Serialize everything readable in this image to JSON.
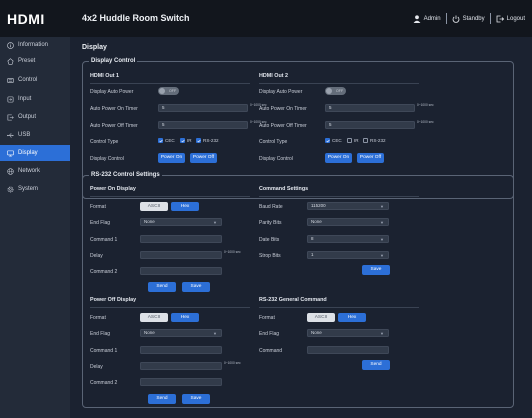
{
  "header": {
    "title": "4x2 Huddle Room Switch",
    "logo": "HDMI",
    "user": "Admin",
    "standby": "Standby",
    "logout": "Logout"
  },
  "sidebar": {
    "items": [
      {
        "label": "Information",
        "icon": "info-icon"
      },
      {
        "label": "Preset",
        "icon": "preset-icon"
      },
      {
        "label": "Control",
        "icon": "control-icon"
      },
      {
        "label": "Input",
        "icon": "input-icon"
      },
      {
        "label": "Output",
        "icon": "output-icon"
      },
      {
        "label": "USB",
        "icon": "usb-icon"
      },
      {
        "label": "Display",
        "icon": "display-icon",
        "active": true
      },
      {
        "label": "Network",
        "icon": "network-icon"
      },
      {
        "label": "System",
        "icon": "system-icon"
      }
    ]
  },
  "page_title": "Display",
  "display_control": {
    "legend": "Display Control",
    "out1": {
      "title": "HDMI Out 1",
      "auto_power_label": "Display Auto Power",
      "auto_power_state": "OFF",
      "on_timer_label": "Auto Power On Timer",
      "on_timer_value": "5",
      "off_timer_label": "Auto Power Off Timer",
      "off_timer_value": "5",
      "unit": "0~1000 sec",
      "control_type_label": "Control Type",
      "cec": "CEC",
      "ir": "IR",
      "rs232": "RS-232",
      "display_control_label": "Display Control",
      "power_on": "Power On",
      "power_off": "Power Off"
    },
    "out2": {
      "title": "HDMI Out 2",
      "auto_power_label": "Display Auto Power",
      "auto_power_state": "OFF",
      "on_timer_label": "Auto Power On Timer",
      "on_timer_value": "5",
      "off_timer_label": "Auto Power Off Timer",
      "off_timer_value": "5",
      "unit": "0~1000 sec",
      "control_type_label": "Control Type",
      "cec": "CEC",
      "ir": "IR",
      "rs232": "RS-232",
      "display_control_label": "Display Control",
      "power_on": "Power On",
      "power_off": "Power Off"
    }
  },
  "rs232": {
    "legend": "RS-232 Control Settings",
    "power_on_display": {
      "title": "Power On Display",
      "format_label": "Format",
      "ascii": "ASCII",
      "hex": "Hex",
      "end_flag_label": "End Flag",
      "end_flag_value": "None",
      "command1_label": "Command 1",
      "command1_value": "",
      "delay_label": "Delay",
      "delay_value": "",
      "unit": "0~1000 sec",
      "command2_label": "Command 2",
      "command2_value": "",
      "send": "Send",
      "save": "Save"
    },
    "command_settings": {
      "title": "Command Settings",
      "baud_label": "Baud Rate",
      "baud_value": "115200",
      "parity_label": "Parity Bits",
      "parity_value": "None",
      "data_label": "Date Bits",
      "data_value": "8",
      "stop_label": "Strop Bits",
      "stop_value": "1",
      "save": "Save"
    },
    "power_off_display": {
      "title": "Power Off Display",
      "format_label": "Format",
      "ascii": "ASCII",
      "hex": "Hex",
      "end_flag_label": "End Flag",
      "end_flag_value": "None",
      "command1_label": "Command 1",
      "command1_value": "",
      "delay_label": "Delay",
      "delay_value": "",
      "unit": "0~1000 sec",
      "command2_label": "Command 2",
      "command2_value": "",
      "send": "Send",
      "save": "Save"
    },
    "general_command": {
      "title": "RS-232 General Command",
      "format_label": "Format",
      "ascii": "ASCII",
      "hex": "Hex",
      "end_flag_label": "End Flag",
      "end_flag_value": "None",
      "command_label": "Command",
      "command_value": "",
      "send": "Send"
    }
  },
  "colors": {
    "accent": "#2c6fd7",
    "background": "#1b2230",
    "sidebar": "#232b39",
    "topbar": "#12161d"
  }
}
